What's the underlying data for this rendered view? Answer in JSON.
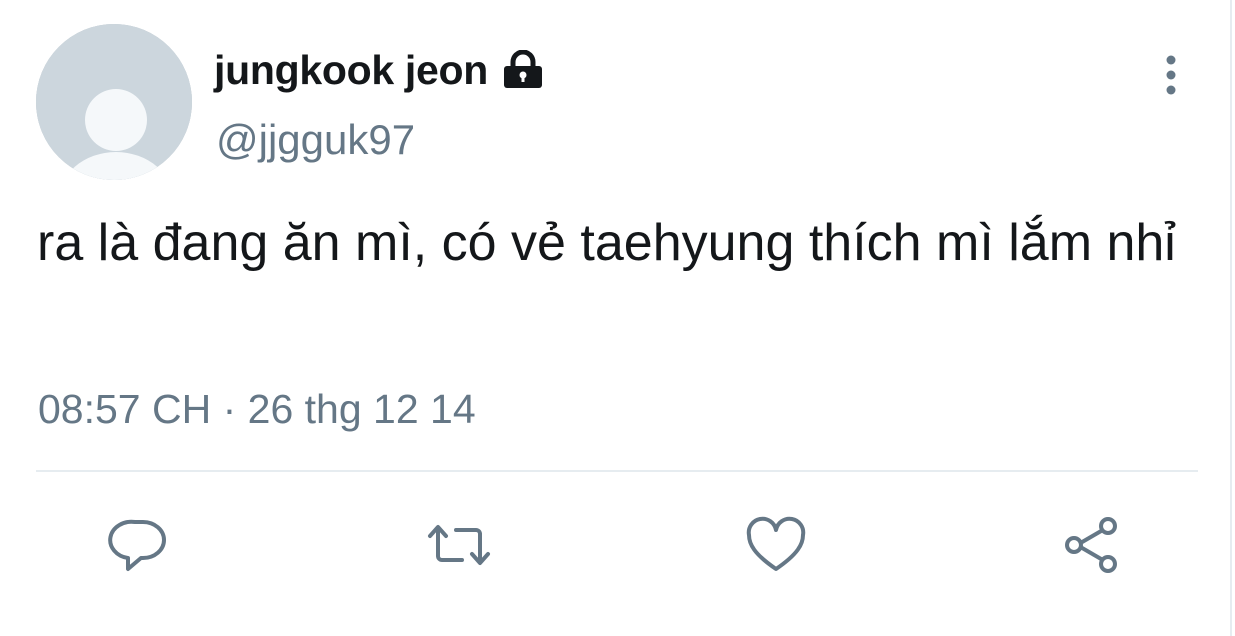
{
  "tweet": {
    "display_name": "jungkook jeon",
    "handle": "@jjgguk97",
    "text": "ra là đang ăn mì, có vẻ taehyung thích mì lắm nhỉ",
    "timestamp": "08:57 CH · 26 thg 12 14",
    "protected": true
  },
  "icons": {
    "lock": "lock-icon",
    "more": "more-vertical-icon",
    "reply": "reply-icon",
    "retweet": "retweet-icon",
    "like": "heart-icon",
    "share": "share-icon"
  },
  "colors": {
    "text": "#14171a",
    "secondary": "#657786",
    "divider": "#e6ecf0",
    "avatar_bg": "#ccd6dd"
  }
}
